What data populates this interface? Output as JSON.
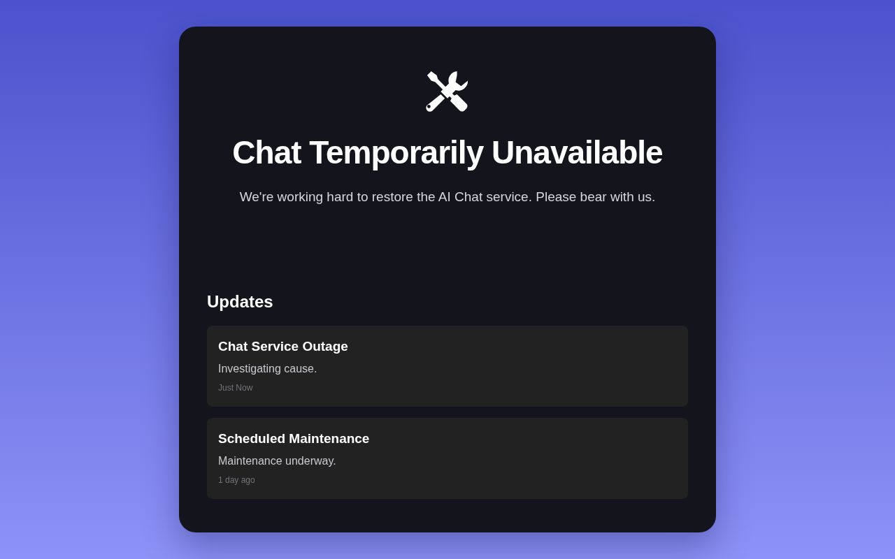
{
  "title": "Chat Temporarily Unavailable",
  "message": "We're working hard to restore the AI Chat service. Please bear with us.",
  "updates": {
    "heading": "Updates",
    "items": [
      {
        "title": "Chat Service Outage",
        "detail": "Investigating cause.",
        "time": "Just Now"
      },
      {
        "title": "Scheduled Maintenance",
        "detail": "Maintenance underway.",
        "time": "1 day ago"
      }
    ]
  }
}
